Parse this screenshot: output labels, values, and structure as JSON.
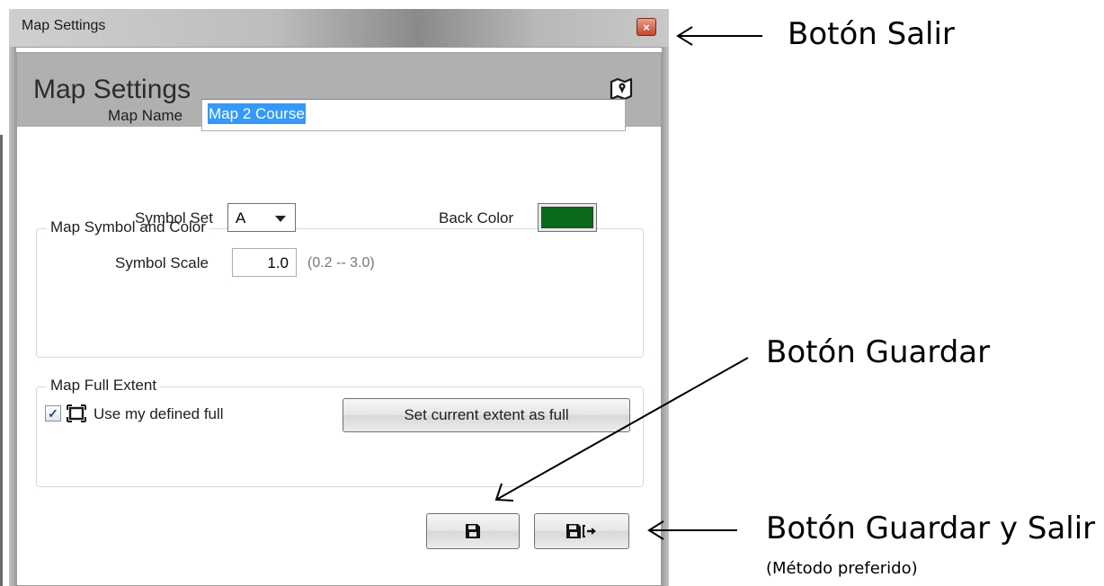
{
  "window": {
    "title": "Map Settings",
    "close_glyph": "×",
    "close_icon": "close-icon"
  },
  "dialog": {
    "header_title": "Map Settings",
    "header_icon": "map-icon",
    "map_name_label": "Map Name",
    "map_name_value": "Map 2 Course",
    "symbol_group": {
      "title": "Map Symbol and Color",
      "symbol_set_label": "Symbol Set",
      "symbol_set_value": "A",
      "back_color_label": "Back Color",
      "back_color": "#0a6b1a",
      "symbol_scale_label": "Symbol Scale",
      "symbol_scale_value": "1.0",
      "symbol_scale_range": "(0.2 -- 3.0)"
    },
    "extent_group": {
      "title": "Map Full Extent",
      "checkbox_checked": true,
      "checkbox_glyph": "✓",
      "use_defined_label": "Use my defined full",
      "set_extent_button": "Set current extent as full"
    },
    "save_icon": "save-icon",
    "save_exit_icon": "save-exit-icon"
  },
  "annotations": {
    "exit": "Botón Salir",
    "save": "Botón Guardar",
    "save_exit": "Botón Guardar y Salir",
    "preferred": "(Método preferido)"
  }
}
